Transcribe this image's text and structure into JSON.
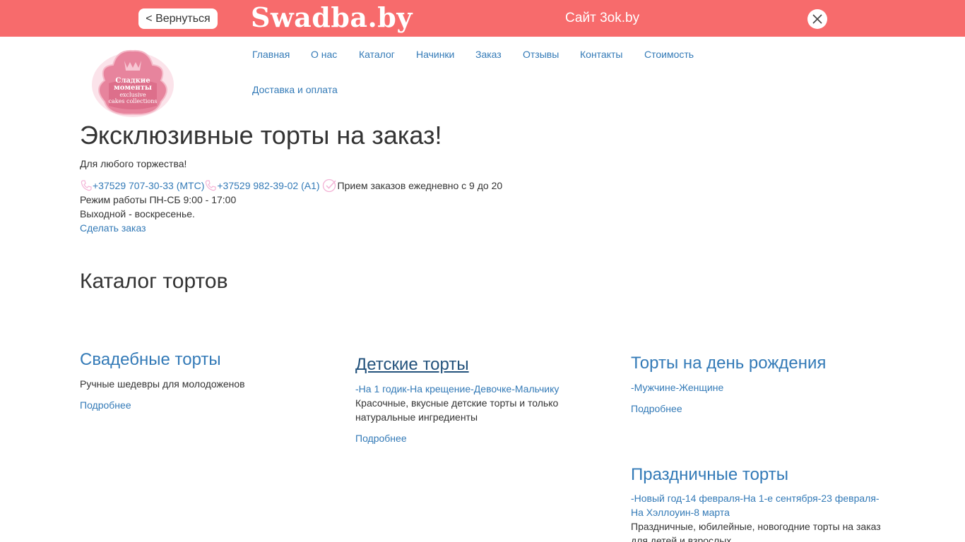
{
  "topbar": {
    "back_label": "< Вернуться",
    "brand": "Swadba.by",
    "zok_label": "Сайт 3ok.by",
    "close_icon": "close-icon",
    "bg_color": "#f76b6c"
  },
  "logo": {
    "line1": "Сладкие",
    "line2": "моменты",
    "line3": "exclusive",
    "line4": "cakes collections"
  },
  "nav": {
    "items": [
      {
        "label": "Главная"
      },
      {
        "label": "О нас"
      },
      {
        "label": "Каталог"
      },
      {
        "label": "Начинки"
      },
      {
        "label": "Заказ"
      },
      {
        "label": "Отзывы"
      },
      {
        "label": "Контакты"
      },
      {
        "label": "Стоимость"
      },
      {
        "label": "Доставка и оплата"
      }
    ]
  },
  "hero": {
    "title": "Эксклюзивные торты на заказ!",
    "tagline": "Для любого торжества!",
    "phone_mts": "+37529 707-30-33 (МТС)",
    "phone_a1": "+37529 982-39-02 (А1)",
    "orders_note": "Прием заказов ежедневно с 9 до 20",
    "hours": "Режим работы ПН-СБ 9:00 - 17:00",
    "day_off": "Выходной - воскресенье.",
    "order_link": "Сделать заказ"
  },
  "catalog": {
    "heading": "Каталог тортов",
    "cards": [
      {
        "title": "Свадебные торты",
        "sub": "",
        "desc": "Ручные шедевры для молодоженов",
        "more": "Подробнее"
      },
      {
        "title": "Детские торты",
        "sub": "-На 1 годик-На крещение-Девочке-Мальчику",
        "desc_line1": "Красочные, вкусные детские торты и только",
        "desc_line2": "натуральные ингредиенты",
        "more": "Подробнее"
      },
      {
        "title": "Торты на день рождения",
        "sub": "-Мужчине-Женщине",
        "more": "Подробнее"
      },
      {
        "title": "Праздничные торты",
        "sub_line1": "-Новый год-14 февраля-На 1-е сентября-23 февраля-",
        "sub_line2": "На Хэллоуин-8 марта",
        "desc_line1": "Праздничные, юбилейные, новогодние торты на заказ",
        "desc_line2": "для детей и взрослых"
      }
    ]
  }
}
